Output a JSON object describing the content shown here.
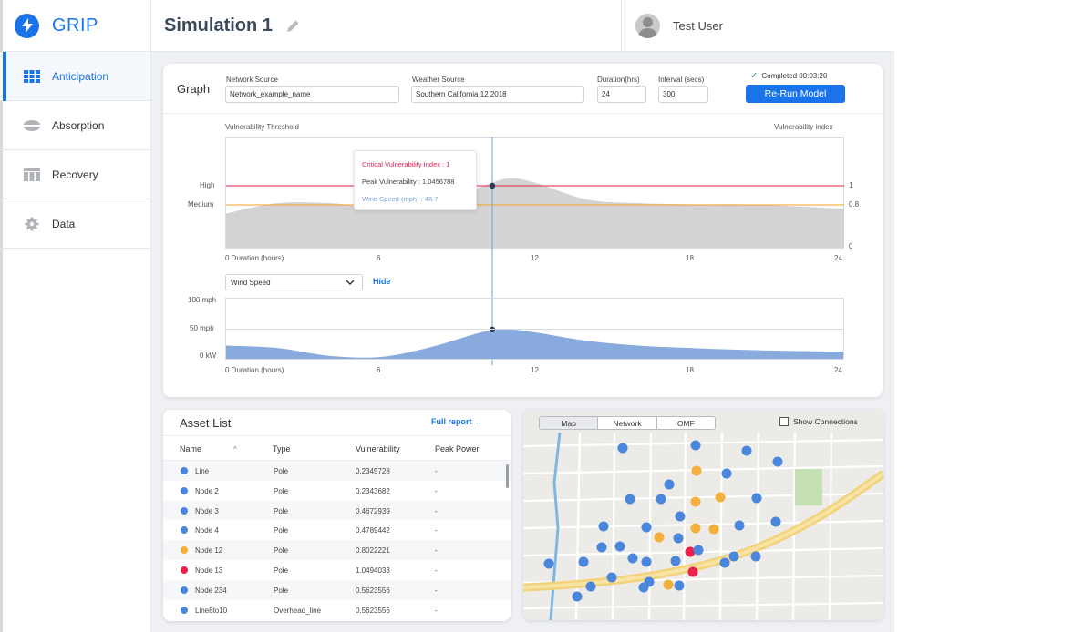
{
  "app": {
    "name": "GRIP"
  },
  "sidebar": {
    "items": [
      {
        "label": "Anticipation",
        "icon": "grid-icon",
        "active": true
      },
      {
        "label": "Absorption",
        "icon": "absorption-icon",
        "active": false
      },
      {
        "label": "Recovery",
        "icon": "recovery-icon",
        "active": false
      },
      {
        "label": "Data",
        "icon": "gear-icon",
        "active": false
      }
    ]
  },
  "header": {
    "title": "Simulation 1",
    "user_name": "Test User"
  },
  "graph": {
    "title": "Graph",
    "network_source": {
      "label": "Network Source",
      "value": "Network_example_name"
    },
    "weather_source": {
      "label": "Weather Source",
      "value": "Southern California 12 2018"
    },
    "duration": {
      "label": "Duration(hrs)",
      "value": "24"
    },
    "interval": {
      "label": "Interval (secs)",
      "value": "300"
    },
    "completed": "Completed 00:03:20",
    "rerun_label": "Re-Run Model",
    "top_left_label": "Vulnerability Threshold",
    "top_right_label": "Vulnerability index",
    "level_high": "High",
    "level_medium": "Medium",
    "right_ticks": [
      "1",
      "0.8",
      "0"
    ],
    "x_axis_first": "0  Duration (hours)",
    "x_ticks": [
      "6",
      "12",
      "18",
      "24"
    ],
    "tooltip": {
      "critical": "Critical Vulnerability Index : 1",
      "peak": "Peak Vulnerability : 1.0456788",
      "wind": "Wind Speed (mph) : 48.7"
    },
    "wind_select": "Wind Speed",
    "hide_label": "Hide",
    "wind_y_ticks": [
      "100 mph",
      "50 mph",
      "0 kW"
    ]
  },
  "chart_data": [
    {
      "type": "area",
      "x": [
        0,
        2,
        4,
        6,
        8,
        10,
        11,
        12,
        14,
        16,
        18,
        20,
        22,
        24
      ],
      "values": [
        0.55,
        0.72,
        0.72,
        0.64,
        0.7,
        1.0,
        1.12,
        1.05,
        0.78,
        0.72,
        0.7,
        0.7,
        0.67,
        0.63
      ],
      "xlim": [
        0,
        24
      ],
      "thresholds": [
        {
          "label": "High",
          "value": 1
        },
        {
          "label": "Medium",
          "value": 0.8
        }
      ],
      "cursor_x": 10.5
    },
    {
      "type": "area",
      "x": [
        0,
        2,
        4,
        6,
        8,
        10,
        11,
        12,
        14,
        16,
        18,
        20,
        22,
        24
      ],
      "values": [
        22,
        18,
        5,
        3,
        20,
        45,
        48.7,
        44,
        30,
        22,
        18,
        15,
        13,
        12
      ],
      "xlim": [
        0,
        24
      ],
      "ylim": [
        0,
        100
      ],
      "cursor_x": 10.5
    }
  ],
  "assets": {
    "title": "Asset List",
    "full_report": "Full report →",
    "columns": [
      "Name",
      "Type",
      "Vulnerability",
      "Peak Power"
    ],
    "sort_indicator": "^",
    "rows": [
      {
        "name": "Line",
        "type": "Pole",
        "vulnerability": "0.2345728",
        "peak": "-",
        "color": "#4a86dc"
      },
      {
        "name": "Node 2",
        "type": "Pole",
        "vulnerability": "0.2343682",
        "peak": "-",
        "color": "#4a86dc"
      },
      {
        "name": "Node 3",
        "type": "Pole",
        "vulnerability": "0.4672939",
        "peak": "-",
        "color": "#4a86dc"
      },
      {
        "name": "Node 4",
        "type": "Pole",
        "vulnerability": "0.4789442",
        "peak": "-",
        "color": "#4a86dc"
      },
      {
        "name": "Node 12",
        "type": "Pole",
        "vulnerability": "0.8022221",
        "peak": "-",
        "color": "#f4b03c"
      },
      {
        "name": "Node 13",
        "type": "Pole",
        "vulnerability": "1.0494033",
        "peak": "-",
        "color": "#e8224d"
      },
      {
        "name": "Node 234",
        "type": "Pole",
        "vulnerability": "0.5623556",
        "peak": "-",
        "color": "#4a86dc"
      },
      {
        "name": "Line8to10",
        "type": "Overhead_line",
        "vulnerability": "0.5623556",
        "peak": "-",
        "color": "#4a86dc"
      }
    ]
  },
  "map": {
    "tabs": [
      "Map",
      "Network",
      "OMF"
    ],
    "active_tab": "Map",
    "show_connections": "Show Connections",
    "colors": {
      "low": "#4a86dc",
      "medium": "#f4b03c",
      "high": "#e8224d"
    }
  }
}
